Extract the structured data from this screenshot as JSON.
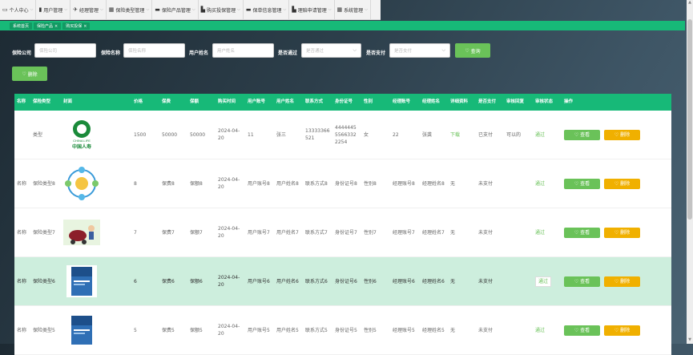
{
  "nav": [
    {
      "icon": "▭",
      "label": "个人中心"
    },
    {
      "icon": "▮",
      "label": "用户管理"
    },
    {
      "icon": "✈",
      "label": "经理管理"
    },
    {
      "icon": "▦",
      "label": "保险类型管理"
    },
    {
      "icon": "▬",
      "label": "保险产品管理"
    },
    {
      "icon": "▙",
      "label": "购买投保管理"
    },
    {
      "icon": "▬",
      "label": "保单信息管理"
    },
    {
      "icon": "▙",
      "label": "理赔申请管理"
    },
    {
      "icon": "▦",
      "label": "系统管理"
    }
  ],
  "tabs": [
    "系统首页",
    "保险产品",
    "购买投保"
  ],
  "search": {
    "company_label": "保险公司",
    "company_placeholder": "保险公司",
    "name_label": "保险名称",
    "name_placeholder": "保险名称",
    "user_label": "用户姓名",
    "user_placeholder": "用户姓名",
    "pass_label": "是否通过",
    "pass_placeholder": "是否通过",
    "pay_label": "是否支付",
    "pay_placeholder": "是否支付",
    "query_label": "查询",
    "delete_label": "删除"
  },
  "columns": [
    "名称",
    "保险类型",
    "封面",
    "价格",
    "保费",
    "保额",
    "购买时间",
    "用户账号",
    "用户姓名",
    "联系方式",
    "身份证号",
    "性别",
    "经理账号",
    "经理姓名",
    "详细资料",
    "是否支付",
    "审核回复",
    "审核状态",
    "操作"
  ],
  "rows": [
    {
      "name": "",
      "type": "类型",
      "cover": "logo",
      "price": "1500",
      "premium": "50000",
      "coverage": "50000",
      "time": "2024-04-20",
      "account": "11",
      "username": "张三",
      "phone": "13333366521",
      "idcard": "444444555663322254",
      "gender": "女",
      "mgr_acc": "22",
      "mgr_name": "张龚",
      "detail": "下载",
      "paid": "已支付",
      "reply": "可以的",
      "status": "通过",
      "view": "查看",
      "del": "删除"
    },
    {
      "name": "名称",
      "type": "保险类型8",
      "cover": "diagram",
      "price": "8",
      "premium": "保费8",
      "coverage": "保额8",
      "time": "2024-04-20",
      "account": "用户账号8",
      "username": "用户姓名8",
      "phone": "联系方式8",
      "idcard": "身份证号8",
      "gender": "性别8",
      "mgr_acc": "经理账号8",
      "mgr_name": "经理姓名8",
      "detail": "无",
      "paid": "未支付",
      "reply": "",
      "status": "通过",
      "view": "查看",
      "del": "删除"
    },
    {
      "name": "名称",
      "type": "保险类型7",
      "cover": "cart",
      "price": "7",
      "premium": "保费7",
      "coverage": "保额7",
      "time": "2024-04-20",
      "account": "用户账号7",
      "username": "用户姓名7",
      "phone": "联系方式7",
      "idcard": "身份证号7",
      "gender": "性别7",
      "mgr_acc": "经理账号7",
      "mgr_name": "经理姓名7",
      "detail": "无",
      "paid": "未支付",
      "reply": "",
      "status": "通过",
      "view": "查看",
      "del": "删除"
    },
    {
      "name": "名称",
      "type": "保险类型6",
      "cover": "book",
      "price": "6",
      "premium": "保费6",
      "coverage": "保额6",
      "time": "2024-04-20",
      "account": "用户账号6",
      "username": "用户姓名6",
      "phone": "联系方式6",
      "idcard": "身份证号6",
      "gender": "性别6",
      "mgr_acc": "经理账号6",
      "mgr_name": "经理姓名6",
      "detail": "无",
      "paid": "未支付",
      "reply": "",
      "status": "通过",
      "view": "查看",
      "del": "删除"
    },
    {
      "name": "名称",
      "type": "保险类型5",
      "cover": "book",
      "price": "5",
      "premium": "保费5",
      "coverage": "保额5",
      "time": "2024-04-20",
      "account": "用户账号5",
      "username": "用户姓名5",
      "phone": "联系方式5",
      "idcard": "身份证号5",
      "gender": "性别5",
      "mgr_acc": "经理账号5",
      "mgr_name": "经理姓名5",
      "detail": "无",
      "paid": "未支付",
      "reply": "",
      "status": "通过",
      "view": "查看",
      "del": "删除"
    }
  ],
  "logo_text": "CHINA LIFE 中国人寿",
  "colors": {
    "accent": "#17b978",
    "button_green": "#6ac259",
    "button_orange": "#f0b000",
    "highlight_row": "#cdeedd"
  }
}
